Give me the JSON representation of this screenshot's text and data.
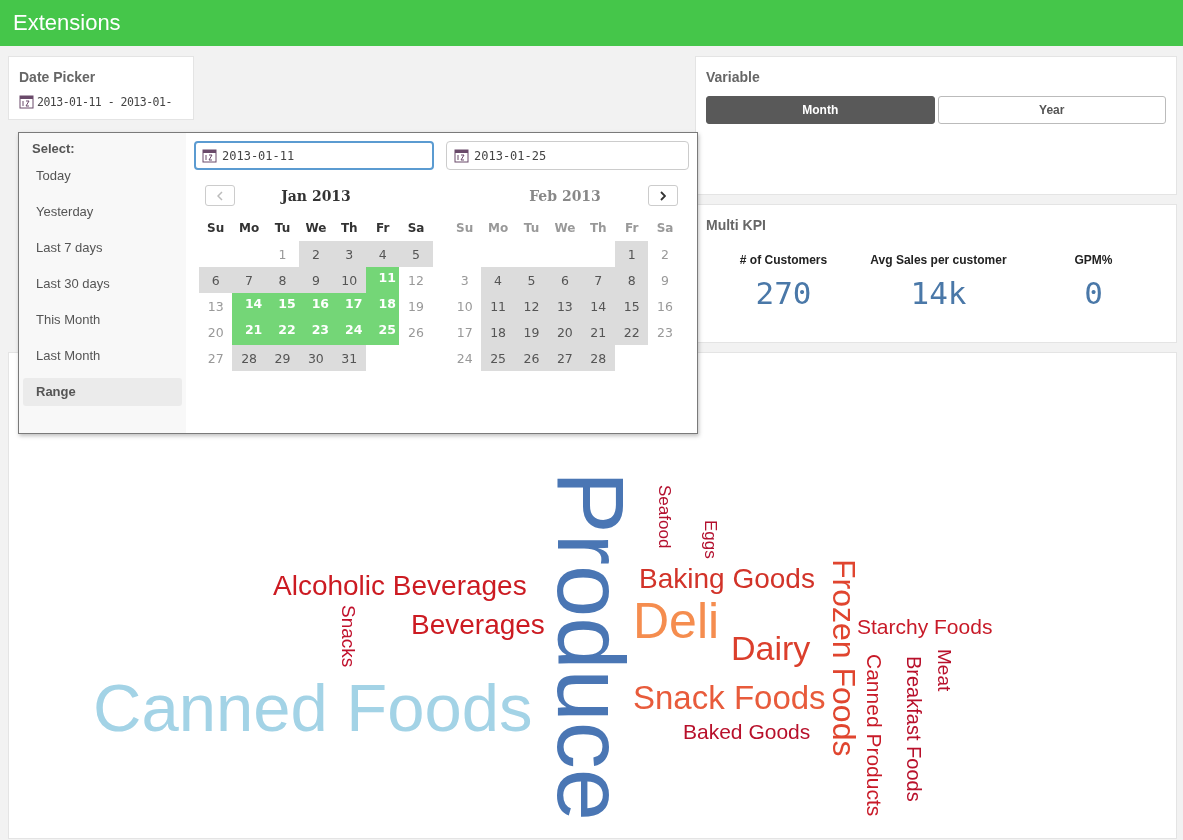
{
  "app": {
    "title": "Extensions"
  },
  "date_picker": {
    "title": "Date Picker",
    "value": "2013-01-11 - 2013-01-"
  },
  "popup": {
    "select_label": "Select:",
    "presets": [
      {
        "label": "Today",
        "selected": false
      },
      {
        "label": "Yesterday",
        "selected": false
      },
      {
        "label": "Last 7 days",
        "selected": false
      },
      {
        "label": "Last 30 days",
        "selected": false
      },
      {
        "label": "This Month",
        "selected": false
      },
      {
        "label": "Last Month",
        "selected": false
      },
      {
        "label": "Range",
        "selected": true
      }
    ],
    "fields": [
      {
        "value": "2013-01-11",
        "focused": true
      },
      {
        "value": "2013-01-25",
        "focused": false
      }
    ],
    "months": [
      {
        "title": "Jan 2013",
        "active": true,
        "weekdays": [
          "Su",
          "Mo",
          "Tu",
          "We",
          "Th",
          "Fr",
          "Sa"
        ],
        "weeks": [
          {
            "days": [
              {
                "day": "1",
                "kind": "plain",
                "selected": false
              },
              {
                "day": "2",
                "kind": "shaded",
                "selected": false
              },
              {
                "day": "3",
                "kind": "shaded",
                "selected": false
              },
              {
                "day": "4",
                "kind": "shaded",
                "selected": false
              },
              {
                "day": "5",
                "kind": "shaded",
                "selected": false
              }
            ]
          },
          {
            "days": [
              {
                "day": "6",
                "kind": "shaded",
                "selected": false
              },
              {
                "day": "7",
                "kind": "shaded",
                "selected": false
              },
              {
                "day": "8",
                "kind": "shaded",
                "selected": false
              },
              {
                "day": "9",
                "kind": "shaded",
                "selected": false
              },
              {
                "day": "10",
                "kind": "shaded",
                "selected": false
              },
              {
                "day": "11",
                "kind": "shaded",
                "selected": true
              },
              {
                "day": "12",
                "kind": "plain",
                "selected": false
              }
            ]
          },
          {
            "days": [
              {
                "day": "13",
                "kind": "plain",
                "selected": false
              },
              {
                "day": "14",
                "kind": "shaded",
                "selected": true
              },
              {
                "day": "15",
                "kind": "shaded",
                "selected": true
              },
              {
                "day": "16",
                "kind": "shaded",
                "selected": true
              },
              {
                "day": "17",
                "kind": "shaded",
                "selected": true
              },
              {
                "day": "18",
                "kind": "shaded",
                "selected": true
              },
              {
                "day": "19",
                "kind": "plain",
                "selected": false
              }
            ]
          },
          {
            "days": [
              {
                "day": "20",
                "kind": "plain",
                "selected": false
              },
              {
                "day": "21",
                "kind": "shaded",
                "selected": true
              },
              {
                "day": "22",
                "kind": "shaded",
                "selected": true
              },
              {
                "day": "23",
                "kind": "shaded",
                "selected": true
              },
              {
                "day": "24",
                "kind": "shaded",
                "selected": true
              },
              {
                "day": "25",
                "kind": "shaded",
                "selected": true
              },
              {
                "day": "26",
                "kind": "plain",
                "selected": false
              }
            ]
          },
          {
            "days": [
              {
                "day": "27",
                "kind": "plain",
                "selected": false
              },
              {
                "day": "28",
                "kind": "shaded",
                "selected": false
              },
              {
                "day": "29",
                "kind": "shaded",
                "selected": false
              },
              {
                "day": "30",
                "kind": "shaded",
                "selected": false
              },
              {
                "day": "31",
                "kind": "shaded",
                "selected": false
              }
            ]
          }
        ]
      },
      {
        "title": "Feb 2013",
        "active": false,
        "weekdays": [
          "Su",
          "Mo",
          "Tu",
          "We",
          "Th",
          "Fr",
          "Sa"
        ],
        "weeks": [
          {
            "days": [
              {
                "day": "1",
                "kind": "shaded",
                "selected": false
              },
              {
                "day": "2",
                "kind": "plain",
                "selected": false
              }
            ]
          },
          {
            "days": [
              {
                "day": "3",
                "kind": "plain",
                "selected": false
              },
              {
                "day": "4",
                "kind": "shaded",
                "selected": false
              },
              {
                "day": "5",
                "kind": "shaded",
                "selected": false
              },
              {
                "day": "6",
                "kind": "shaded",
                "selected": false
              },
              {
                "day": "7",
                "kind": "shaded",
                "selected": false
              },
              {
                "day": "8",
                "kind": "shaded",
                "selected": false
              },
              {
                "day": "9",
                "kind": "plain",
                "selected": false
              }
            ]
          },
          {
            "days": [
              {
                "day": "10",
                "kind": "plain",
                "selected": false
              },
              {
                "day": "11",
                "kind": "shaded",
                "selected": false
              },
              {
                "day": "12",
                "kind": "shaded",
                "selected": false
              },
              {
                "day": "13",
                "kind": "shaded",
                "selected": false
              },
              {
                "day": "14",
                "kind": "shaded",
                "selected": false
              },
              {
                "day": "15",
                "kind": "shaded",
                "selected": false
              },
              {
                "day": "16",
                "kind": "plain",
                "selected": false
              }
            ]
          },
          {
            "days": [
              {
                "day": "17",
                "kind": "plain",
                "selected": false
              },
              {
                "day": "18",
                "kind": "shaded",
                "selected": false
              },
              {
                "day": "19",
                "kind": "shaded",
                "selected": false
              },
              {
                "day": "20",
                "kind": "shaded",
                "selected": false
              },
              {
                "day": "21",
                "kind": "shaded",
                "selected": false
              },
              {
                "day": "22",
                "kind": "shaded",
                "selected": false
              },
              {
                "day": "23",
                "kind": "plain",
                "selected": false
              }
            ]
          },
          {
            "days": [
              {
                "day": "24",
                "kind": "plain",
                "selected": false
              },
              {
                "day": "25",
                "kind": "shaded",
                "selected": false
              },
              {
                "day": "26",
                "kind": "shaded",
                "selected": false
              },
              {
                "day": "27",
                "kind": "shaded",
                "selected": false
              },
              {
                "day": "28",
                "kind": "shaded",
                "selected": false
              }
            ]
          }
        ]
      }
    ]
  },
  "variable": {
    "title": "Variable",
    "options": [
      {
        "label": "Month",
        "selected": true
      },
      {
        "label": "Year",
        "selected": false
      }
    ]
  },
  "multi_kpi": {
    "title": "Multi KPI",
    "items": [
      {
        "label": "# of Customers",
        "value": "270"
      },
      {
        "label": "Avg Sales per customer",
        "value": "14k"
      },
      {
        "label": "GPM%",
        "value": "0"
      }
    ]
  },
  "word_cloud": {
    "words": [
      {
        "text": "Produce",
        "kind": "vertical",
        "color": "#4a76b4"
      },
      {
        "text": "Seafood",
        "kind": "vertical",
        "color": "#b3102e"
      },
      {
        "text": "Eggs",
        "kind": "vertical",
        "color": "#b3102e"
      },
      {
        "text": "Frozen Foods",
        "kind": "vertical",
        "color": "#e0452f"
      },
      {
        "text": "Alcoholic Beverages",
        "kind": "horizontal",
        "color": "#cc1b22"
      },
      {
        "text": "Baking Goods",
        "kind": "horizontal",
        "color": "#d23329"
      },
      {
        "text": "Snacks",
        "kind": "vertical",
        "color": "#c0102c"
      },
      {
        "text": "Beverages",
        "kind": "horizontal",
        "color": "#cc1b22"
      },
      {
        "text": "Deli",
        "kind": "horizontal",
        "color": "#f58d4f"
      },
      {
        "text": "Dairy",
        "kind": "horizontal",
        "color": "#db3f2c"
      },
      {
        "text": "Starchy Foods",
        "kind": "horizontal",
        "color": "#c81a28"
      },
      {
        "text": "Canned Products",
        "kind": "vertical",
        "color": "#c81a28"
      },
      {
        "text": "Breakfast Foods",
        "kind": "vertical",
        "color": "#b8102b"
      },
      {
        "text": "Meat",
        "kind": "vertical",
        "color": "#b8102b"
      },
      {
        "text": "Canned Foods",
        "kind": "horizontal",
        "color": "#a3d3e6"
      },
      {
        "text": "Snack Foods",
        "kind": "horizontal",
        "color": "#e85b3b"
      },
      {
        "text": "Baked Goods",
        "kind": "horizontal",
        "color": "#b8102b"
      }
    ]
  }
}
